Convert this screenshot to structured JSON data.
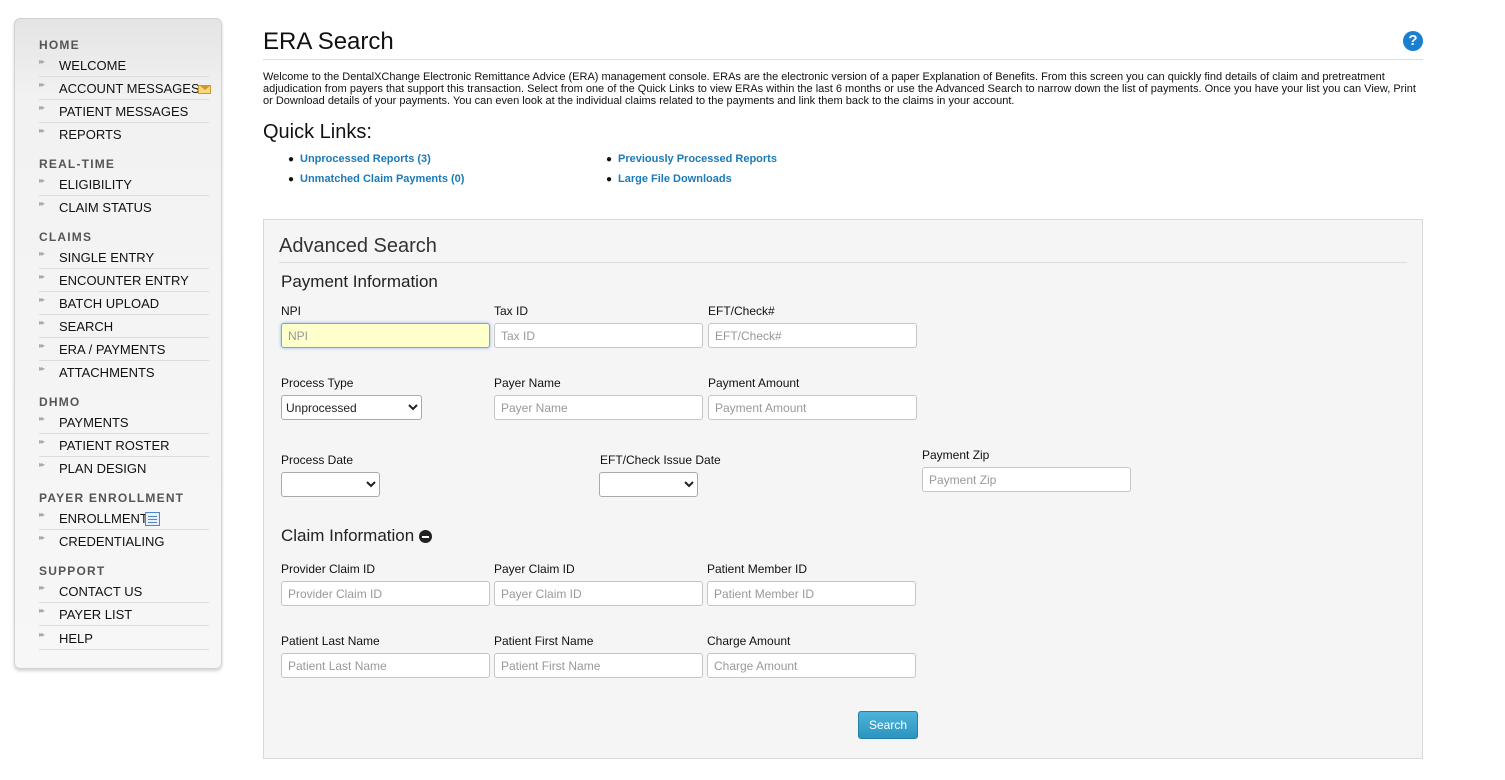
{
  "sidebar": {
    "sections": [
      {
        "title": "HOME",
        "items": [
          {
            "label": "WELCOME"
          },
          {
            "label": "ACCOUNT MESSAGES",
            "icon": "envelope-icon"
          },
          {
            "label": "PATIENT MESSAGES"
          },
          {
            "label": "REPORTS"
          }
        ]
      },
      {
        "title": "REAL-TIME",
        "items": [
          {
            "label": "ELIGIBILITY"
          },
          {
            "label": "CLAIM STATUS"
          }
        ]
      },
      {
        "title": "CLAIMS",
        "items": [
          {
            "label": "SINGLE ENTRY"
          },
          {
            "label": "ENCOUNTER ENTRY"
          },
          {
            "label": "BATCH UPLOAD"
          },
          {
            "label": "SEARCH"
          },
          {
            "label": "ERA / PAYMENTS"
          },
          {
            "label": "ATTACHMENTS"
          }
        ]
      },
      {
        "title": "DHMO",
        "items": [
          {
            "label": "PAYMENTS"
          },
          {
            "label": "PATIENT ROSTER"
          },
          {
            "label": "PLAN DESIGN"
          }
        ]
      },
      {
        "title": "PAYER ENROLLMENT",
        "items": [
          {
            "label": "ENROLLMENT",
            "icon": "document-icon"
          },
          {
            "label": "CREDENTIALING"
          }
        ]
      },
      {
        "title": "SUPPORT",
        "items": [
          {
            "label": "CONTACT US"
          },
          {
            "label": "PAYER LIST"
          },
          {
            "label": "HELP"
          }
        ]
      }
    ]
  },
  "header": {
    "title": "ERA Search",
    "help_glyph": "?"
  },
  "intro_text": "Welcome to the DentalXChange Electronic Remittance Advice (ERA) management console. ERAs are the electronic version of a paper Explanation of Benefits. From this screen you can quickly find details of claim and pretreatment adjudication from payers that support this transaction. Select from one of the Quick Links to view ERAs within the last 6 months or use the Advanced Search to narrow down the list of payments. Once you have your list you can View, Print or Download details of your payments. You can even look at the individual claims related to the payments and link them back to the claims in your account.",
  "quick_links": {
    "title": "Quick Links:",
    "links": [
      "Unprocessed Reports (3)",
      "Unmatched Claim Payments (0)",
      "Previously Processed Reports",
      "Large File Downloads"
    ]
  },
  "advanced_search": {
    "title": "Advanced Search",
    "payment_info": {
      "title": "Payment Information",
      "npi": {
        "label": "NPI",
        "placeholder": "NPI"
      },
      "tax_id": {
        "label": "Tax ID",
        "placeholder": "Tax ID"
      },
      "eft_check": {
        "label": "EFT/Check#",
        "placeholder": "EFT/Check#"
      },
      "process_type": {
        "label": "Process Type",
        "selected": "Unprocessed"
      },
      "payer_name": {
        "label": "Payer Name",
        "placeholder": "Payer Name"
      },
      "payment_amount": {
        "label": "Payment Amount",
        "placeholder": "Payment Amount"
      },
      "process_date": {
        "label": "Process Date",
        "selected": ""
      },
      "eft_issue_date": {
        "label": "EFT/Check Issue Date",
        "selected": ""
      },
      "payment_zip": {
        "label": "Payment Zip",
        "placeholder": "Payment Zip"
      }
    },
    "claim_info": {
      "title": "Claim Information",
      "provider_claim_id": {
        "label": "Provider Claim ID",
        "placeholder": "Provider Claim ID"
      },
      "payer_claim_id": {
        "label": "Payer Claim ID",
        "placeholder": "Payer Claim ID"
      },
      "patient_member_id": {
        "label": "Patient Member ID",
        "placeholder": "Patient Member ID"
      },
      "patient_last_name": {
        "label": "Patient Last Name",
        "placeholder": "Patient Last Name"
      },
      "patient_first_name": {
        "label": "Patient First Name",
        "placeholder": "Patient First Name"
      },
      "charge_amount": {
        "label": "Charge Amount",
        "placeholder": "Charge Amount"
      }
    },
    "search_label": "Search"
  }
}
